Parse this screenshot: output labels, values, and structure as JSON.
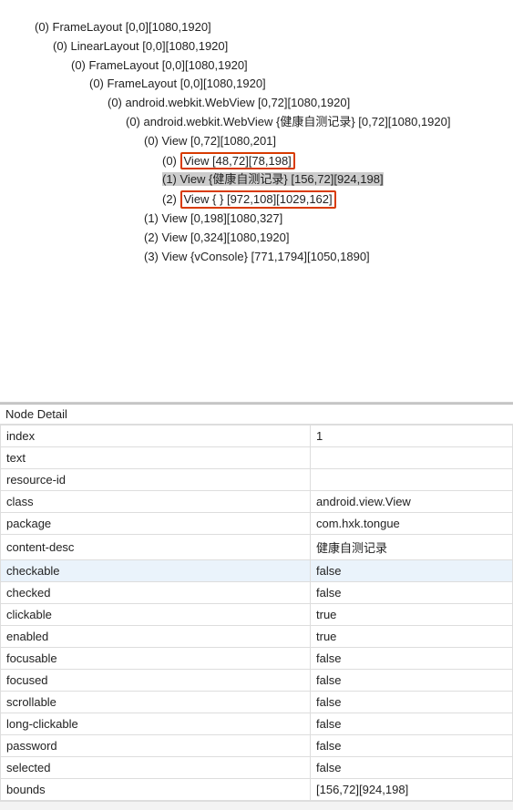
{
  "tree": {
    "n0": "(0) FrameLayout [0,0][1080,1920]",
    "n1": "(0) LinearLayout [0,0][1080,1920]",
    "n2": "(0) FrameLayout [0,0][1080,1920]",
    "n3": "(0) FrameLayout [0,0][1080,1920]",
    "n4": "(0) android.webkit.WebView [0,72][1080,1920]",
    "n5": "(0) android.webkit.WebView {健康自测记录} [0,72][1080,1920]",
    "n6": "(0) View [0,72][1080,201]",
    "n7_pre": "(0) ",
    "n7_box": "View [48,72][78,198]",
    "n8": "(1) View {健康自测记录} [156,72][924,198]",
    "n9_pre": "(2) ",
    "n9_box": "View {   } [972,108][1029,162]",
    "n10": "(1) View [0,198][1080,327]",
    "n11": "(2) View [0,324][1080,1920]",
    "n12": "(3) View {vConsole} [771,1794][1050,1890]"
  },
  "detail_header": "Node Detail",
  "details": [
    {
      "key": "index",
      "val": "1",
      "hl": false
    },
    {
      "key": "text",
      "val": "",
      "hl": false
    },
    {
      "key": "resource-id",
      "val": "",
      "hl": false
    },
    {
      "key": "class",
      "val": "android.view.View",
      "hl": false
    },
    {
      "key": "package",
      "val": "com.hxk.tongue",
      "hl": false
    },
    {
      "key": "content-desc",
      "val": "健康自测记录",
      "hl": false
    },
    {
      "key": "checkable",
      "val": "false",
      "hl": true
    },
    {
      "key": "checked",
      "val": "false",
      "hl": false
    },
    {
      "key": "clickable",
      "val": "true",
      "hl": false
    },
    {
      "key": "enabled",
      "val": "true",
      "hl": false
    },
    {
      "key": "focusable",
      "val": "false",
      "hl": false
    },
    {
      "key": "focused",
      "val": "false",
      "hl": false
    },
    {
      "key": "scrollable",
      "val": "false",
      "hl": false
    },
    {
      "key": "long-clickable",
      "val": "false",
      "hl": false
    },
    {
      "key": "password",
      "val": "false",
      "hl": false
    },
    {
      "key": "selected",
      "val": "false",
      "hl": false
    },
    {
      "key": "bounds",
      "val": "[156,72][924,198]",
      "hl": false
    }
  ]
}
